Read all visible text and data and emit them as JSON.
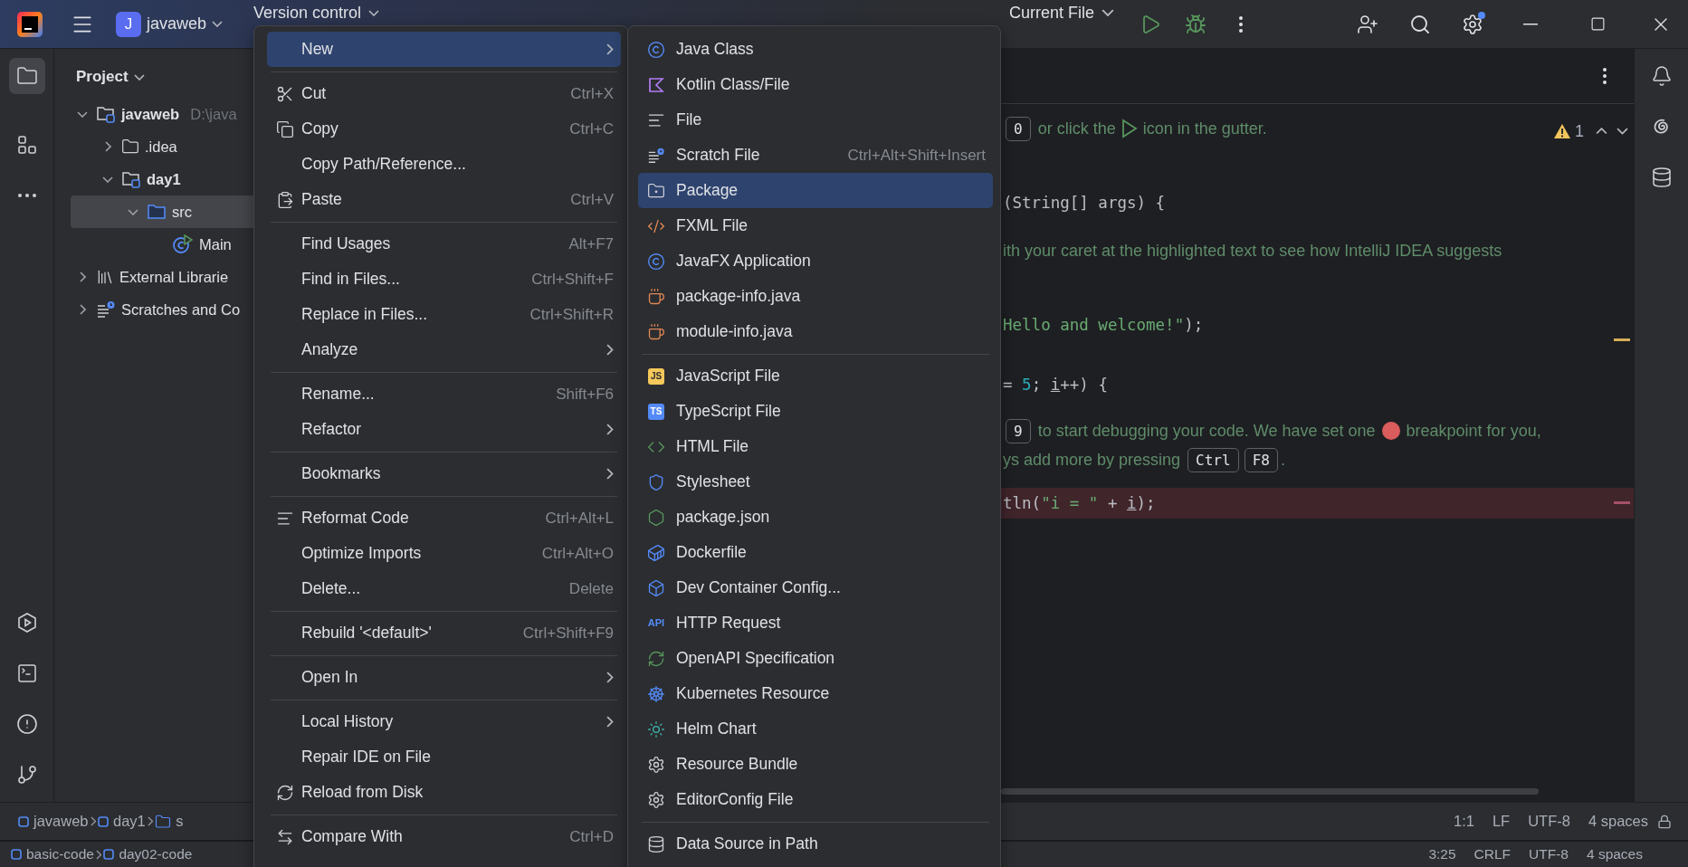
{
  "title_bar": {
    "project_badge": "J",
    "project": "javaweb",
    "vcs": "Version control",
    "run_config": "Current File"
  },
  "project_panel": {
    "title": "Project",
    "tree": [
      {
        "label": "javaweb",
        "path": "D:\\java",
        "kind": "module",
        "expanded": true,
        "selected": false,
        "children": [
          {
            "label": ".idea",
            "kind": "folder",
            "expanded": false,
            "selected": false
          },
          {
            "label": "day1",
            "kind": "module",
            "expanded": true,
            "selected": false,
            "children": [
              {
                "label": "src",
                "kind": "source",
                "expanded": true,
                "selected": true,
                "children": [
                  {
                    "label": "Main",
                    "kind": "class",
                    "selected": false
                  }
                ]
              }
            ]
          }
        ]
      },
      {
        "label": "External Librarie",
        "kind": "libraries",
        "expanded": false,
        "selected": false
      },
      {
        "label": "Scratches and Co",
        "kind": "scratches",
        "expanded": false,
        "selected": false
      }
    ]
  },
  "context_menu": {
    "items": [
      {
        "kind": "item",
        "label": "New",
        "submenu": true,
        "selected": true
      },
      {
        "kind": "separator"
      },
      {
        "kind": "item",
        "label": "Cut",
        "shortcut": "Ctrl+X",
        "selected": false
      },
      {
        "kind": "item",
        "label": "Copy",
        "shortcut": "Ctrl+C",
        "selected": false
      },
      {
        "kind": "item",
        "label": "Copy Path/Reference...",
        "selected": false
      },
      {
        "kind": "item",
        "label": "Paste",
        "shortcut": "Ctrl+V",
        "selected": false
      },
      {
        "kind": "separator"
      },
      {
        "kind": "item",
        "label": "Find Usages",
        "shortcut": "Alt+F7",
        "selected": false
      },
      {
        "kind": "item",
        "label": "Find in Files...",
        "shortcut": "Ctrl+Shift+F",
        "selected": false
      },
      {
        "kind": "item",
        "label": "Replace in Files...",
        "shortcut": "Ctrl+Shift+R",
        "selected": false
      },
      {
        "kind": "item",
        "label": "Analyze",
        "submenu": true,
        "selected": false
      },
      {
        "kind": "separator"
      },
      {
        "kind": "item",
        "label": "Rename...",
        "shortcut": "Shift+F6",
        "selected": false
      },
      {
        "kind": "item",
        "label": "Refactor",
        "submenu": true,
        "selected": false
      },
      {
        "kind": "separator"
      },
      {
        "kind": "item",
        "label": "Bookmarks",
        "submenu": true,
        "selected": false
      },
      {
        "kind": "separator"
      },
      {
        "kind": "item",
        "label": "Reformat Code",
        "shortcut": "Ctrl+Alt+L",
        "selected": false
      },
      {
        "kind": "item",
        "label": "Optimize Imports",
        "shortcut": "Ctrl+Alt+O",
        "selected": false
      },
      {
        "kind": "item",
        "label": "Delete...",
        "shortcut": "Delete",
        "selected": false
      },
      {
        "kind": "separator"
      },
      {
        "kind": "item",
        "label": "Rebuild '<default>'",
        "shortcut": "Ctrl+Shift+F9",
        "selected": false
      },
      {
        "kind": "separator"
      },
      {
        "kind": "item",
        "label": "Open In",
        "submenu": true,
        "selected": false
      },
      {
        "kind": "separator"
      },
      {
        "kind": "item",
        "label": "Local History",
        "submenu": true,
        "selected": false
      },
      {
        "kind": "item",
        "label": "Repair IDE on File",
        "selected": false
      },
      {
        "kind": "item",
        "label": "Reload from Disk",
        "selected": false
      },
      {
        "kind": "separator"
      },
      {
        "kind": "item",
        "label": "Compare With",
        "shortcut": "Ctrl+D",
        "selected": false
      }
    ]
  },
  "new_submenu": {
    "items": [
      {
        "kind": "item",
        "label": "Java Class",
        "selected": false
      },
      {
        "kind": "item",
        "label": "Kotlin Class/File",
        "selected": false
      },
      {
        "kind": "item",
        "label": "File",
        "selected": false
      },
      {
        "kind": "item",
        "label": "Scratch File",
        "shortcut": "Ctrl+Alt+Shift+Insert",
        "selected": false
      },
      {
        "kind": "item",
        "label": "Package",
        "selected": true
      },
      {
        "kind": "item",
        "label": "FXML File",
        "selected": false
      },
      {
        "kind": "item",
        "label": "JavaFX Application",
        "selected": false
      },
      {
        "kind": "item",
        "label": "package-info.java",
        "selected": false
      },
      {
        "kind": "item",
        "label": "module-info.java",
        "selected": false
      },
      {
        "kind": "separator"
      },
      {
        "kind": "item",
        "label": "JavaScript File",
        "icon_label": "JS",
        "selected": false
      },
      {
        "kind": "item",
        "label": "TypeScript File",
        "icon_label": "TS",
        "selected": false
      },
      {
        "kind": "item",
        "label": "HTML File",
        "selected": false
      },
      {
        "kind": "item",
        "label": "Stylesheet",
        "selected": false
      },
      {
        "kind": "item",
        "label": "package.json",
        "selected": false
      },
      {
        "kind": "item",
        "label": "Dockerfile",
        "selected": false
      },
      {
        "kind": "item",
        "label": "Dev Container Config...",
        "selected": false
      },
      {
        "kind": "item",
        "label": "HTTP Request",
        "icon_label": "API",
        "selected": false
      },
      {
        "kind": "item",
        "label": "OpenAPI Specification",
        "selected": false
      },
      {
        "kind": "item",
        "label": "Kubernetes Resource",
        "selected": false
      },
      {
        "kind": "item",
        "label": "Helm Chart",
        "selected": false
      },
      {
        "kind": "item",
        "label": "Resource Bundle",
        "selected": false
      },
      {
        "kind": "item",
        "label": "EditorConfig File",
        "selected": false
      },
      {
        "kind": "separator"
      },
      {
        "kind": "item",
        "label": "Data Source in Path",
        "selected": false
      }
    ]
  },
  "editor": {
    "problems_count": "1",
    "lines": [
      {
        "kind": "hint",
        "breakpoint": false,
        "segments": [
          {
            "kind": "key",
            "text": "0"
          },
          {
            "kind": "text",
            "text": " or click the "
          },
          {
            "kind": "run"
          },
          {
            "kind": "text",
            "text": " icon in the gutter."
          }
        ]
      },
      {
        "kind": "code",
        "breakpoint": false,
        "segments": [
          {
            "kind": "code",
            "text": "(String[] args) {"
          }
        ]
      },
      {
        "kind": "hint",
        "breakpoint": false,
        "segments": [
          {
            "kind": "text",
            "text": "ith your caret at the highlighted text to see how IntelliJ IDEA suggests"
          }
        ]
      },
      {
        "kind": "code",
        "breakpoint": false,
        "segments": [
          {
            "kind": "string",
            "text": "Hello and welcome!\""
          },
          {
            "kind": "code",
            "text": ");"
          }
        ]
      },
      {
        "kind": "code",
        "breakpoint": false,
        "segments": [
          {
            "kind": "code",
            "text": "= "
          },
          {
            "kind": "number",
            "text": "5"
          },
          {
            "kind": "code",
            "text": "; "
          },
          {
            "kind": "var",
            "text": "i"
          },
          {
            "kind": "code",
            "text": "++) {"
          }
        ]
      },
      {
        "kind": "hint",
        "breakpoint": false,
        "segments": [
          {
            "kind": "key",
            "text": "9"
          },
          {
            "kind": "text",
            "text": " to start debugging your code. We have set one "
          },
          {
            "kind": "dot"
          },
          {
            "kind": "text",
            "text": " breakpoint for you,"
          }
        ]
      },
      {
        "kind": "hint",
        "breakpoint": false,
        "segments": [
          {
            "kind": "text",
            "text": "ys add more by pressing "
          },
          {
            "kind": "key",
            "text": "Ctrl"
          },
          {
            "kind": "key",
            "text": "F8"
          },
          {
            "kind": "text",
            "text": "."
          }
        ]
      },
      {
        "kind": "code",
        "breakpoint": true,
        "segments": [
          {
            "kind": "code",
            "text": "tln("
          },
          {
            "kind": "string",
            "text": "\"i = \""
          },
          {
            "kind": "code",
            "text": " + "
          },
          {
            "kind": "var",
            "text": "i"
          },
          {
            "kind": "code",
            "text": ");"
          }
        ]
      }
    ]
  },
  "status_bar": {
    "breadcrumbs": [
      {
        "label": "javaweb",
        "kind": "module"
      },
      {
        "label": "day1",
        "kind": "module"
      },
      {
        "label": "s",
        "kind": "folder"
      }
    ],
    "position": "1:1",
    "line_ending": "LF",
    "encoding": "UTF-8",
    "indent": "4 spaces"
  },
  "status_bar_2": {
    "breadcrumbs": [
      {
        "label": "basic-code",
        "kind": "module"
      },
      {
        "label": "day02-code",
        "kind": "module"
      }
    ],
    "position": "3:25",
    "line_ending": "CRLF",
    "encoding": "UTF-8",
    "indent": "4 spaces"
  }
}
